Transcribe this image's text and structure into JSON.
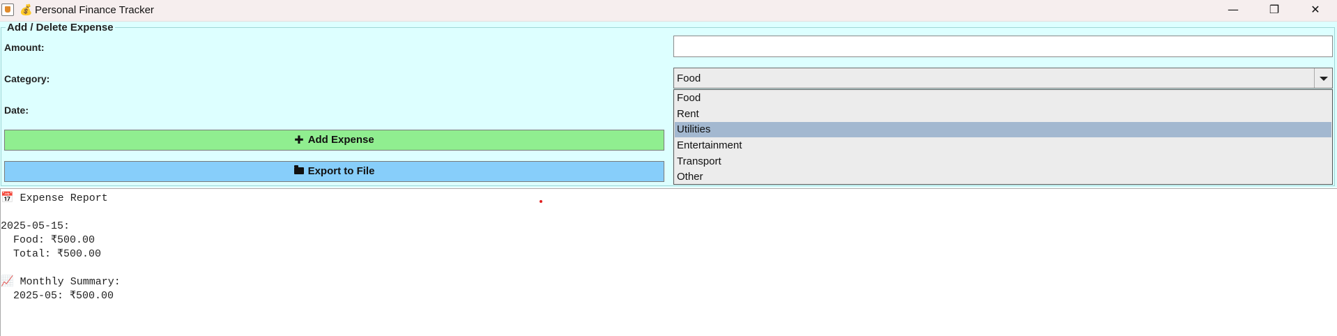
{
  "window": {
    "title": "Personal Finance Tracker",
    "title_icon": "money-bag-icon",
    "title_emoji": "💰",
    "controls": {
      "minimize": "—",
      "maximize": "❐",
      "close": "✕"
    }
  },
  "form": {
    "group_title": "Add / Delete Expense",
    "amount_label": "Amount:",
    "amount_value": "",
    "category_label": "Category:",
    "category_value": "Food",
    "date_label": "Date:",
    "categories": [
      "Food",
      "Rent",
      "Utilities",
      "Entertainment",
      "Transport",
      "Other"
    ],
    "highlighted_category": "Utilities",
    "add_button": {
      "label": "Add Expense",
      "icon": "plus-icon",
      "color": "#90ee90"
    },
    "export_button": {
      "label": "Export to File",
      "icon": "folder-icon",
      "color": "#87cefa"
    },
    "background": "#ddffff"
  },
  "report": {
    "text": "📅 Expense Report\n\n2025-05-15:\n  Food: ₹500.00\n  Total: ₹500.00\n\n📈 Monthly Summary:\n  2025-05: ₹500.00"
  }
}
